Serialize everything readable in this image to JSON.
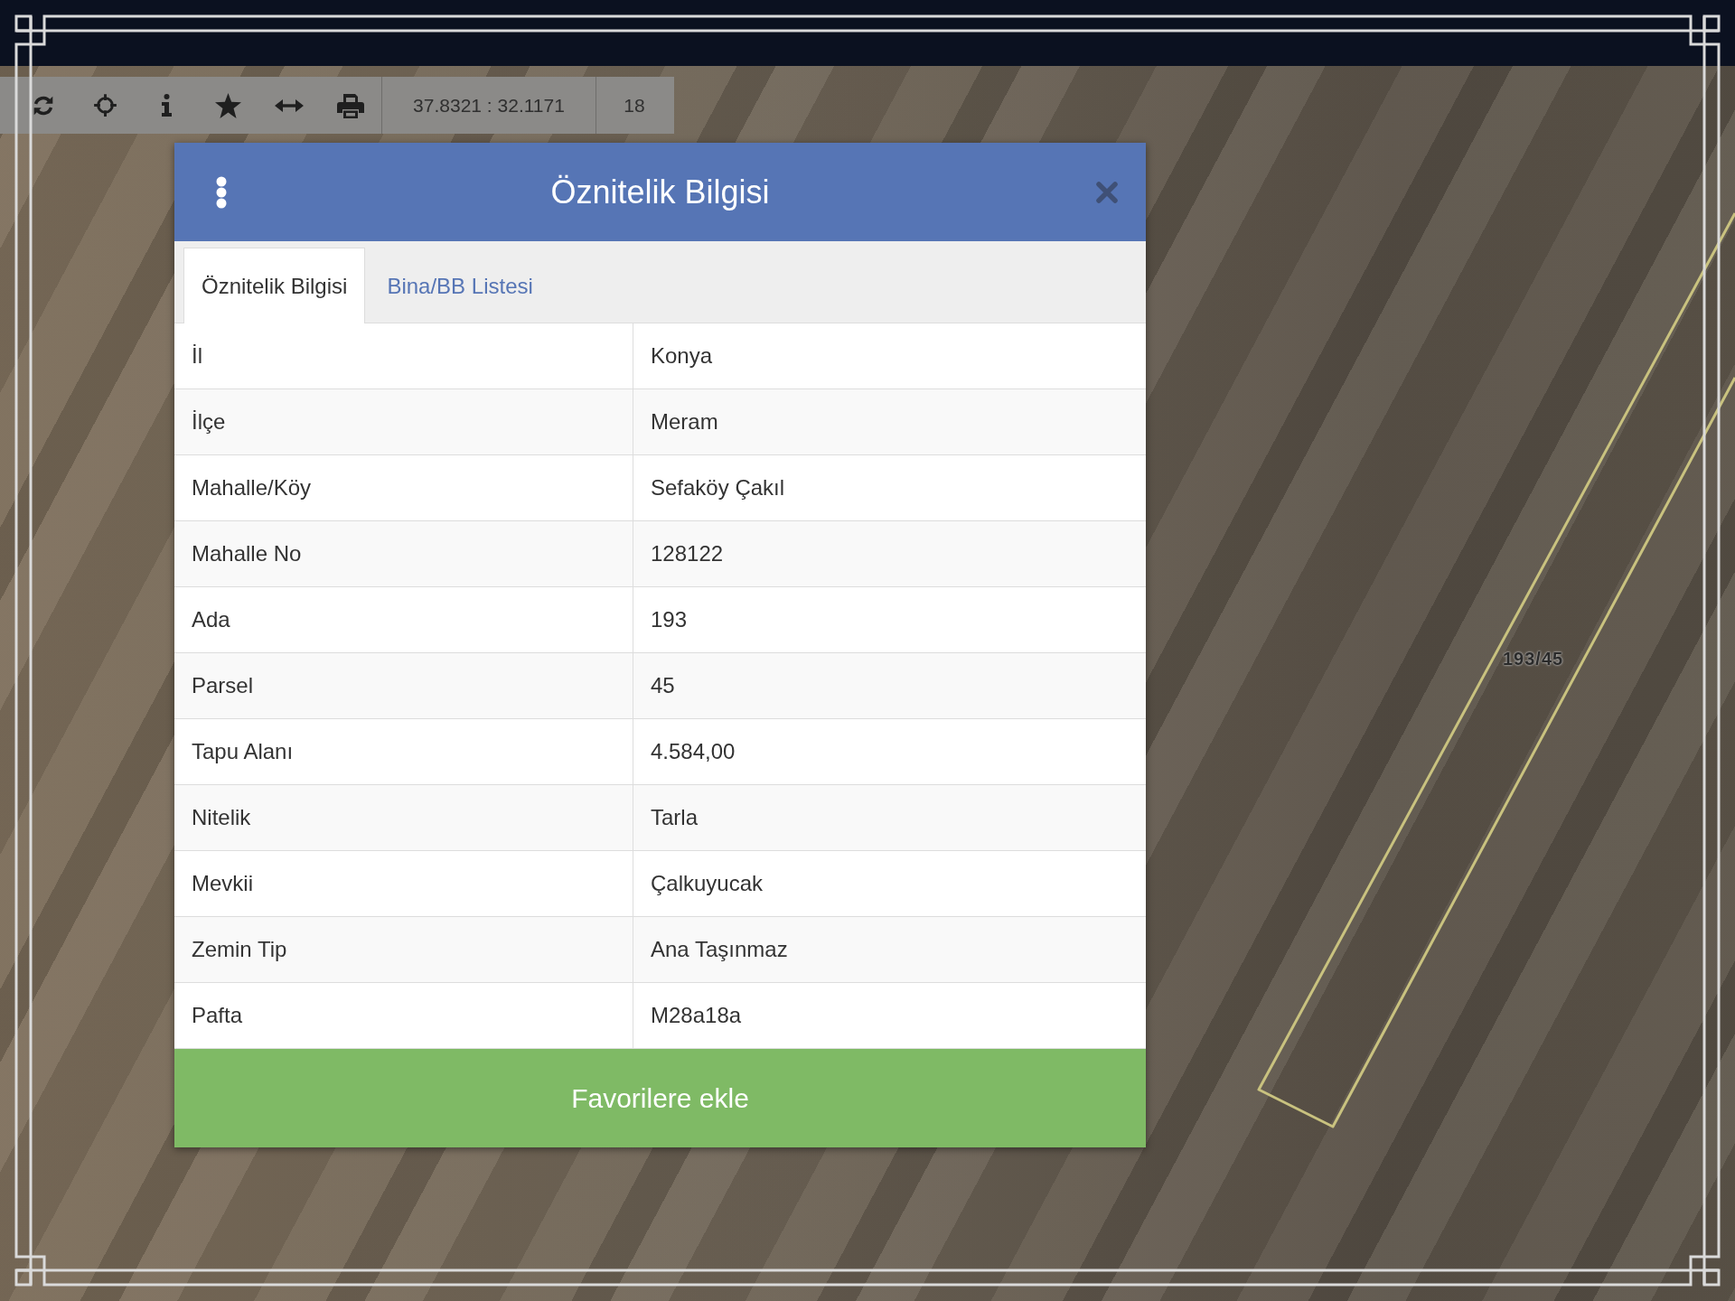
{
  "toolbar": {
    "coordinates": "37.8321 : 32.1171",
    "zoom_level": "18"
  },
  "map": {
    "parcel_label": "193/45"
  },
  "dialog": {
    "title": "Öznitelik Bilgisi",
    "tabs": [
      {
        "label": "Öznitelik Bilgisi",
        "selected": true
      },
      {
        "label": "Bina/BB Listesi",
        "selected": false
      }
    ],
    "rows": [
      {
        "label": "İl",
        "value": "Konya"
      },
      {
        "label": "İlçe",
        "value": "Meram"
      },
      {
        "label": "Mahalle/Köy",
        "value": "Sefaköy Çakıl"
      },
      {
        "label": "Mahalle No",
        "value": "128122"
      },
      {
        "label": "Ada",
        "value": "193"
      },
      {
        "label": "Parsel",
        "value": "45"
      },
      {
        "label": "Tapu Alanı",
        "value": "4.584,00"
      },
      {
        "label": "Nitelik",
        "value": "Tarla"
      },
      {
        "label": "Mevkii",
        "value": "Çalkuyucak"
      },
      {
        "label": "Zemin Tip",
        "value": "Ana Taşınmaz"
      },
      {
        "label": "Pafta",
        "value": "M28a18a"
      }
    ],
    "button": "Favorilere ekle"
  }
}
